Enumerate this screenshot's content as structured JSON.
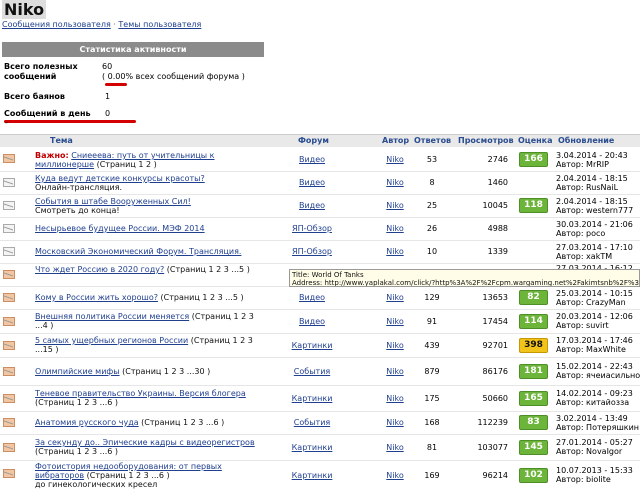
{
  "page": {
    "title": "Niko",
    "crumb_messages": "Сообщения пользователя",
    "crumb_sep": "·",
    "crumb_topics": "Темы пользователя"
  },
  "stats": {
    "header": "Статистика активности",
    "useful_label": "Всего полезных сообщений",
    "useful_value": "60",
    "percent_prefix": "(",
    "percent_value": "0.00%",
    "percent_suffix": "всех сообщений форума )",
    "bans_label": "Всего баянов",
    "bans_value": "1",
    "per_day_label": "Сообщений в день",
    "per_day_value": "0",
    "dash": "-"
  },
  "table_headers": {
    "topic": "Тема",
    "forum": "Форум",
    "author": "Автор",
    "answers": "Ответов",
    "views": "Просмотров",
    "score": "Оценка",
    "update": "Обновление"
  },
  "tooltip": {
    "line1": "Title: World Of Tanks",
    "line2": "Address: http://www.yaplakal.com/click/?http%3A%2F%2Fcpm.wargaming.net%2Fakimtsnb%2F%3Fpub_id%3D"
  },
  "colors": {
    "score_green": "#6db43b",
    "score_yellow": "#f2c31a",
    "important_red": "#c00000"
  },
  "rows": [
    {
      "important": "Важно:",
      "title": "Сниееева: путь от учительницы к миллионерше",
      "pages": "(Страниц 1 2 )",
      "desc": "",
      "forum": "Видео",
      "author": "Niko",
      "answers": "53",
      "views": "2746",
      "score": "166",
      "date": "3.04.2014 - 20:43",
      "last_author": "Автор: MrRIP"
    },
    {
      "important": "",
      "title": "Куда ведут детские конкурсы красоты?",
      "pages": "",
      "desc": "Онлайн-трансляция.",
      "forum": "Видео",
      "author": "Niko",
      "answers": "8",
      "views": "1460",
      "score": "",
      "date": "2.04.2014 - 18:15",
      "last_author": "Автор: RusNaiL"
    },
    {
      "important": "",
      "title": "События в штабе Вооруженных Сил!",
      "pages": "",
      "desc": "Смотреть до конца!",
      "forum": "Видео",
      "author": "Niko",
      "answers": "25",
      "views": "10045",
      "score": "118",
      "date": "2.04.2014 - 18:15",
      "last_author": "Автор: western777"
    },
    {
      "important": "",
      "title": "Несырьевое будущее России. МЭФ 2014",
      "pages": "",
      "desc": "",
      "forum": "ЯП-Обзор",
      "author": "Niko",
      "answers": "26",
      "views": "4988",
      "score": "",
      "date": "30.03.2014 - 21:06",
      "last_author": "Автор: poco"
    },
    {
      "important": "",
      "title": "Московский Экономический Форум. Трансляция.",
      "pages": "",
      "desc": "",
      "forum": "ЯП-Обзор",
      "author": "Niko",
      "answers": "10",
      "views": "1339",
      "score": "",
      "date": "27.03.2014 - 17:10",
      "last_author": "Автор: xakTM"
    },
    {
      "important": "",
      "title": "Что ждет Россию в 2020 году?",
      "pages": "(Страниц 1 2 3 ...5 )",
      "desc": "",
      "forum": "",
      "author": "",
      "answers": "",
      "views": "",
      "score": "",
      "date": "27.03.2014 - 16:12",
      "last_author": ""
    },
    {
      "important": "",
      "title": "Кому в России жить хорошо?",
      "pages": "(Страниц 1 2 3 ...5 )",
      "desc": "",
      "forum": "Видео",
      "author": "Niko",
      "answers": "129",
      "views": "13653",
      "score": "82",
      "date": "25.03.2014 - 10:15",
      "last_author": "Автор: CrazyMan"
    },
    {
      "important": "",
      "title": "Внешняя политика России меняется",
      "pages": "(Страниц 1 2 3 ...4 )",
      "desc": "",
      "forum": "Видео",
      "author": "Niko",
      "answers": "91",
      "views": "17454",
      "score": "114",
      "date": "20.03.2014 - 12:06",
      "last_author": "Автор: suvirt"
    },
    {
      "important": "",
      "title": "5 самых ущербных регионов России",
      "pages": "(Страниц 1 2 3 ...15 )",
      "desc": "",
      "forum": "Картинки",
      "author": "Niko",
      "answers": "439",
      "views": "92701",
      "score": "398",
      "date": "17.03.2014 - 17:46",
      "last_author": "Автор: MaxWhite"
    },
    {
      "important": "",
      "title": "Олимпийские мифы",
      "pages": "(Страниц 1 2 3 ...30 )",
      "desc": "",
      "forum": "События",
      "author": "Niko",
      "answers": "879",
      "views": "86176",
      "score": "181",
      "date": "15.02.2014 - 22:43",
      "last_author": "Автор: ячеиасильнолпакала"
    },
    {
      "important": "",
      "title": "Теневое правительство Украины. Версия блогера",
      "pages": "(Страниц 1 2 3 ...6 )",
      "desc": "",
      "forum": "Картинки",
      "author": "Niko",
      "answers": "175",
      "views": "50660",
      "score": "165",
      "date": "14.02.2014 - 09:23",
      "last_author": "Автор: китайозза"
    },
    {
      "important": "",
      "title": "Анатомия русского чуда",
      "pages": "(Страниц 1 2 3 ...6 )",
      "desc": "",
      "forum": "События",
      "author": "Niko",
      "answers": "168",
      "views": "112239",
      "score": "83",
      "date": "3.02.2014 - 13:49",
      "last_author": "Автор: Потеряшкин"
    },
    {
      "important": "",
      "title": "За секунду до.. Эпические кадры с видеорегистров",
      "pages": "(Страниц 1 2 3 ...6 )",
      "desc": "",
      "forum": "Картинки",
      "author": "Niko",
      "answers": "81",
      "views": "103077",
      "score": "145",
      "date": "27.01.2014 - 05:27",
      "last_author": "Автор: NovaIgor"
    },
    {
      "important": "",
      "title": "Фотоистория недооборудования: от первых вибраторов",
      "pages": "(Страниц 1 2 3 ...6 )",
      "desc": "до гинекологических кресел",
      "forum": "Картинки",
      "author": "Niko",
      "answers": "169",
      "views": "96214",
      "score": "102",
      "date": "10.07.2013 - 15:33",
      "last_author": "Автор: biolite"
    }
  ]
}
